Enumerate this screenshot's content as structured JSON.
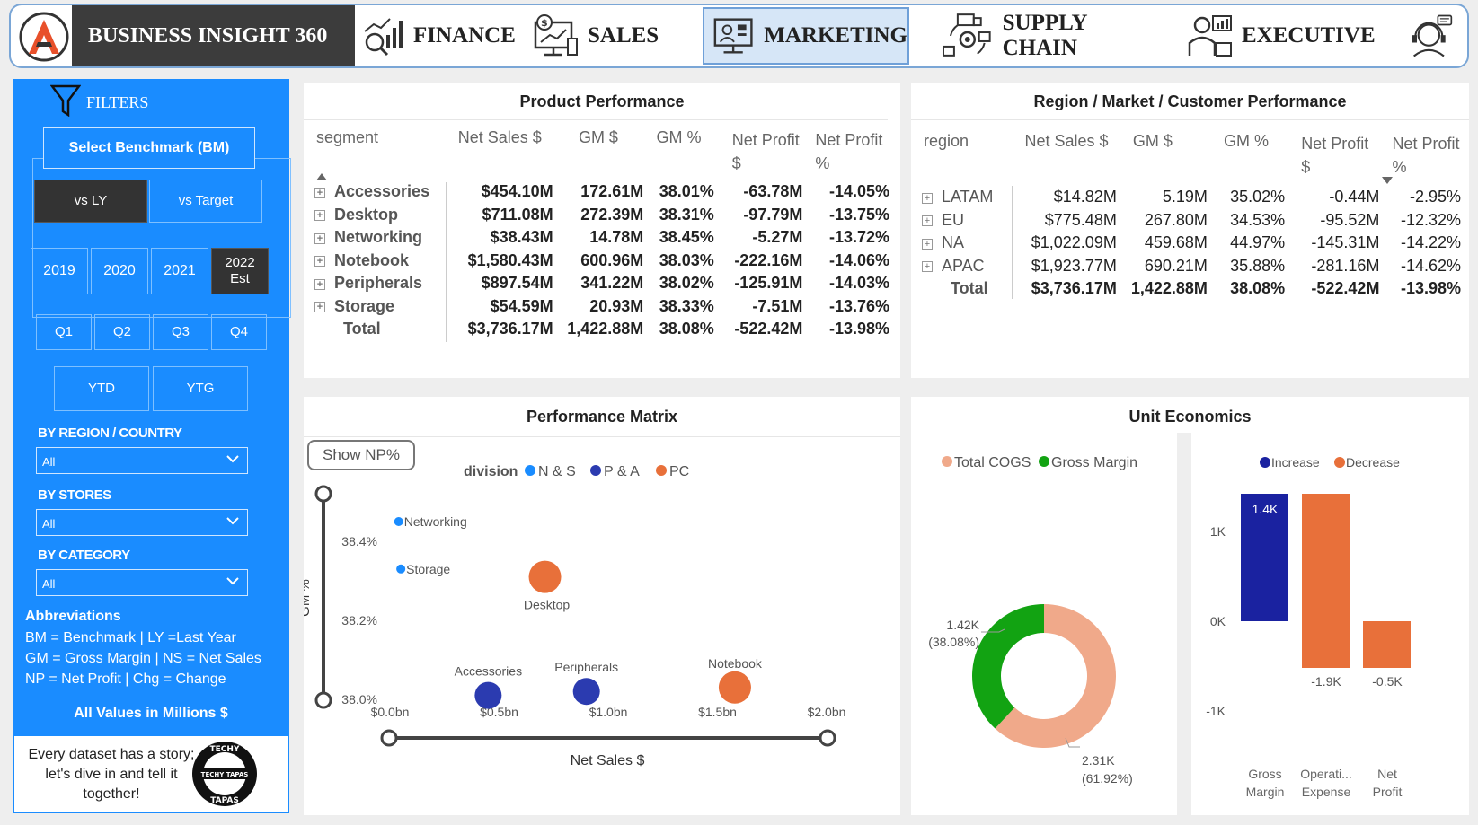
{
  "brand": "BUSINESS INSIGHT 360",
  "nav": [
    {
      "label": "FINANCE",
      "icon": "finance-icon",
      "active": false
    },
    {
      "label": "SALES",
      "icon": "sales-icon",
      "active": false
    },
    {
      "label": "MARKETING",
      "icon": "marketing-icon",
      "active": true
    },
    {
      "label": "SUPPLY CHAIN",
      "icon": "supply-chain-icon",
      "active": false
    },
    {
      "label": "EXECUTIVE",
      "icon": "executive-icon",
      "active": false
    }
  ],
  "sidebar": {
    "filters_label": "FILTERS",
    "benchmark_label": "Select Benchmark (BM)",
    "bm_options": [
      "vs LY",
      "vs Target"
    ],
    "bm_selected": "vs LY",
    "years": [
      "2019",
      "2020",
      "2021",
      "2022 Est"
    ],
    "year_selected": "2022 Est",
    "quarters": [
      "Q1",
      "Q2",
      "Q3",
      "Q4"
    ],
    "ytd": [
      "YTD",
      "YTG"
    ],
    "region_label": "BY REGION / COUNTRY",
    "region_value": "All",
    "stores_label": "BY STORES",
    "stores_value": "All",
    "category_label": "BY CATEGORY",
    "category_value": "All",
    "abbr_title": "Abbreviations",
    "abbr_lines": [
      "BM = Benchmark | LY =Last Year",
      "GM = Gross Margin | NS = Net Sales",
      "NP = Net Profit | Chg = Change"
    ],
    "values_note": "All Values in Millions $",
    "story": "Every dataset has a story; let's dive in and tell it together!",
    "badge_top": "TECHY",
    "badge_mid": "TECHY TAPAS",
    "badge_bottom": "TAPAS"
  },
  "product": {
    "title": "Product Performance",
    "headers": [
      "segment",
      "Net Sales $",
      "GM $",
      "GM %",
      "Net Profit $",
      "Net Profit %"
    ],
    "rows": [
      [
        "Accessories",
        "$454.10M",
        "172.61M",
        "38.01%",
        "-63.78M",
        "-14.05%"
      ],
      [
        "Desktop",
        "$711.08M",
        "272.39M",
        "38.31%",
        "-97.79M",
        "-13.75%"
      ],
      [
        "Networking",
        "$38.43M",
        "14.78M",
        "38.45%",
        "-5.27M",
        "-13.72%"
      ],
      [
        "Notebook",
        "$1,580.43M",
        "600.96M",
        "38.03%",
        "-222.16M",
        "-14.06%"
      ],
      [
        "Peripherals",
        "$897.54M",
        "341.22M",
        "38.02%",
        "-125.91M",
        "-14.03%"
      ],
      [
        "Storage",
        "$54.59M",
        "20.93M",
        "38.33%",
        "-7.51M",
        "-13.76%"
      ]
    ],
    "total": [
      "Total",
      "$3,736.17M",
      "1,422.88M",
      "38.08%",
      "-522.42M",
      "-13.98%"
    ]
  },
  "region": {
    "title": "Region  / Market / Customer Performance",
    "headers": [
      "region",
      "Net Sales $",
      "GM $",
      "GM %",
      "Net Profit $",
      "Net Profit %"
    ],
    "rows": [
      [
        "LATAM",
        "$14.82M",
        "5.19M",
        "35.02%",
        "-0.44M",
        "-2.95%"
      ],
      [
        "EU",
        "$775.48M",
        "267.80M",
        "34.53%",
        "-95.52M",
        "-12.32%"
      ],
      [
        "NA",
        "$1,022.09M",
        "459.68M",
        "44.97%",
        "-145.31M",
        "-14.22%"
      ],
      [
        "APAC",
        "$1,923.77M",
        "690.21M",
        "35.88%",
        "-281.16M",
        "-14.62%"
      ]
    ],
    "total": [
      "Total",
      "$3,736.17M",
      "1,422.88M",
      "38.08%",
      "-522.42M",
      "-13.98%"
    ]
  },
  "matrix": {
    "title": "Performance Matrix",
    "show_np_label": "Show NP%",
    "legend_title": "division",
    "xlabel": "Net Sales $",
    "ylabel": "GM %"
  },
  "unit": {
    "title": "Unit Economics"
  },
  "chart_data": [
    {
      "type": "scatter",
      "title": "Performance Matrix",
      "xlabel": "Net Sales $",
      "ylabel": "GM %",
      "xlim": [
        0,
        2
      ],
      "ylim": [
        38.0,
        38.5
      ],
      "x_ticks": [
        "$0.0bn",
        "$0.5bn",
        "$1.0bn",
        "$1.5bn",
        "$2.0bn"
      ],
      "y_ticks": [
        "38.0%",
        "38.2%",
        "38.4%"
      ],
      "legend": [
        {
          "name": "N & S",
          "color": "#1a8cff"
        },
        {
          "name": "P & A",
          "color": "#2b3bb0"
        },
        {
          "name": "PC",
          "color": "#e8703a"
        }
      ],
      "points": [
        {
          "label": "Networking",
          "x": 0.04,
          "y": 38.45,
          "series": "N & S"
        },
        {
          "label": "Storage",
          "x": 0.05,
          "y": 38.33,
          "series": "N & S"
        },
        {
          "label": "Desktop",
          "x": 0.71,
          "y": 38.31,
          "series": "PC"
        },
        {
          "label": "Accessories",
          "x": 0.45,
          "y": 38.01,
          "series": "P & A"
        },
        {
          "label": "Peripherals",
          "x": 0.9,
          "y": 38.02,
          "series": "P & A"
        },
        {
          "label": "Notebook",
          "x": 1.58,
          "y": 38.03,
          "series": "PC"
        }
      ]
    },
    {
      "type": "pie",
      "legend": [
        "Total COGS",
        "Gross Margin"
      ],
      "slices": [
        {
          "name": "Gross Margin",
          "value_label": "1.42K",
          "pct_label": "(38.08%)",
          "value": 1.42,
          "color": "#12a312"
        },
        {
          "name": "Total COGS",
          "value_label": "2.31K",
          "pct_label": "(61.92%)",
          "value": 2.31,
          "color": "#f0a98a"
        }
      ]
    },
    {
      "type": "bar",
      "legend": [
        {
          "name": "Increase",
          "color": "#1a22a0"
        },
        {
          "name": "Decrease",
          "color": "#e8703a"
        }
      ],
      "categories": [
        "Gross Margin",
        "Operati... Expense",
        "Net Profit"
      ],
      "ylim": [
        -1.1,
        1.5
      ],
      "y_ticks": [
        "1K",
        "0K",
        "-1K"
      ],
      "bars": [
        {
          "start": 0,
          "end": 1.42,
          "label": "1.4K",
          "kind": "Increase"
        },
        {
          "start": 1.42,
          "end": -0.52,
          "label": "-1.9K",
          "kind": "Decrease"
        },
        {
          "start": -0.52,
          "end": 0,
          "label": "-0.5K",
          "kind": "Decrease"
        }
      ]
    }
  ]
}
